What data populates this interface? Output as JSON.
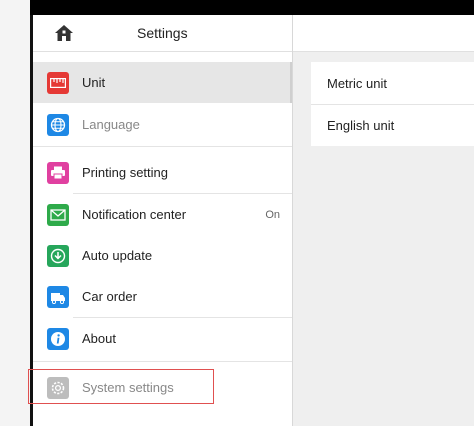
{
  "sidebar": {
    "title": "Settings",
    "items": [
      {
        "label": "Unit",
        "icon": "ruler-icon",
        "color": "#e53935"
      },
      {
        "label": "Language",
        "icon": "globe-icon",
        "color": "#1e88e5"
      },
      {
        "label": "Printing setting",
        "icon": "printer-icon",
        "color": "#e040a0"
      },
      {
        "label": "Notification center",
        "icon": "message-icon",
        "color": "#2eaa4a",
        "value": "On"
      },
      {
        "label": "Auto update",
        "icon": "download-icon",
        "color": "#26a65b"
      },
      {
        "label": "Car order",
        "icon": "car-order-icon",
        "color": "#1e88e5"
      },
      {
        "label": "About",
        "icon": "info-icon",
        "color": "#1e88e5"
      },
      {
        "label": "System settings",
        "icon": "gear-icon",
        "color": "#bdbdbd"
      }
    ]
  },
  "unit_options": [
    {
      "label": "Metric unit"
    },
    {
      "label": "English unit"
    }
  ]
}
